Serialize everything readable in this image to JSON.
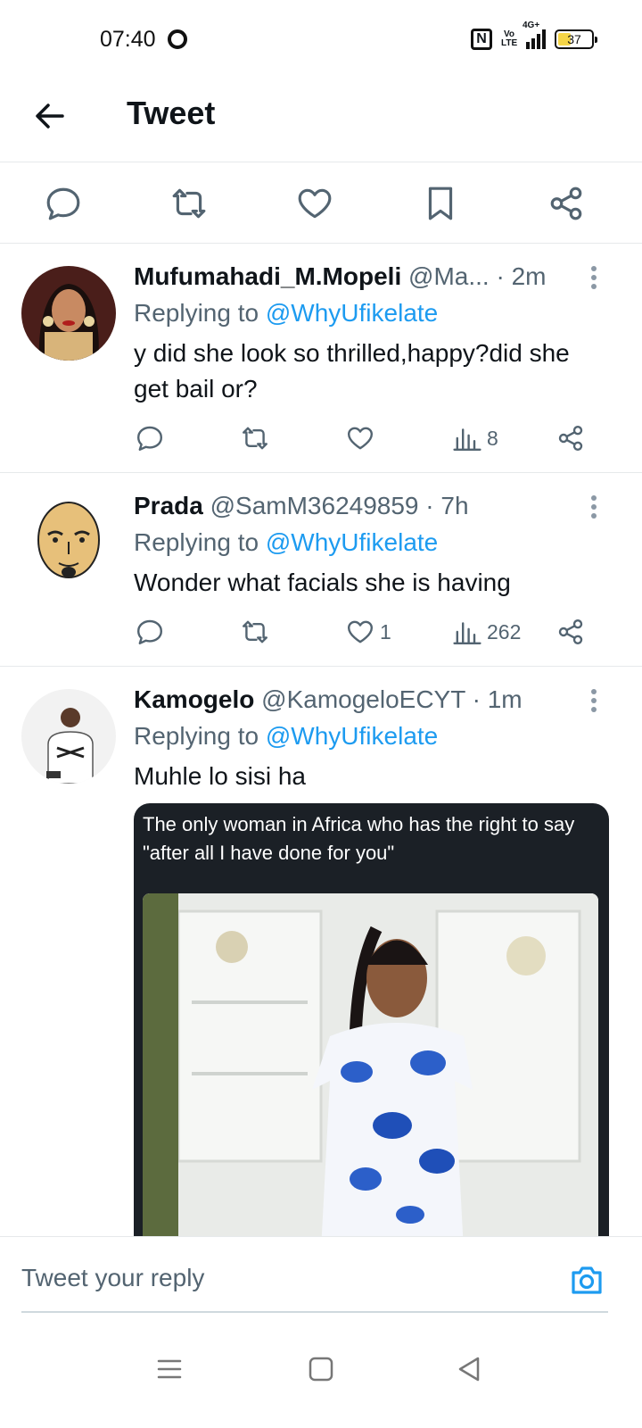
{
  "status_bar": {
    "time": "07:40",
    "network": "4G+",
    "volte": "Vo LTE",
    "battery": "37"
  },
  "header": {
    "title": "Tweet"
  },
  "replies": [
    {
      "name": "Mufumahadi_M.Mopeli",
      "handle": "@Ma...",
      "time": "· 2m",
      "replying_prefix": "Replying to",
      "replying_to": "@WhyUfikelate",
      "text": "y did she look so thrilled,happy?did she get bail or?",
      "likes": "",
      "views": "8"
    },
    {
      "name": "Prada",
      "handle": "@SamM36249859",
      "time": "· 7h",
      "replying_prefix": "Replying to",
      "replying_to": "@WhyUfikelate",
      "text": "Wonder what facials she is having",
      "likes": "1",
      "views": "262"
    },
    {
      "name": "Kamogelo",
      "handle": "@KamogeloECYT",
      "time": "· 1m",
      "replying_prefix": "Replying to",
      "replying_to": "@WhyUfikelate",
      "text": "Muhle lo sisi ha",
      "media_caption": "The only woman in Africa who has the right to say \"after all I have done for you\""
    }
  ],
  "reply_bar": {
    "placeholder": "Tweet your reply"
  },
  "colors": {
    "accent": "#1d9bf0",
    "muted": "#536471",
    "text": "#0f1419"
  }
}
